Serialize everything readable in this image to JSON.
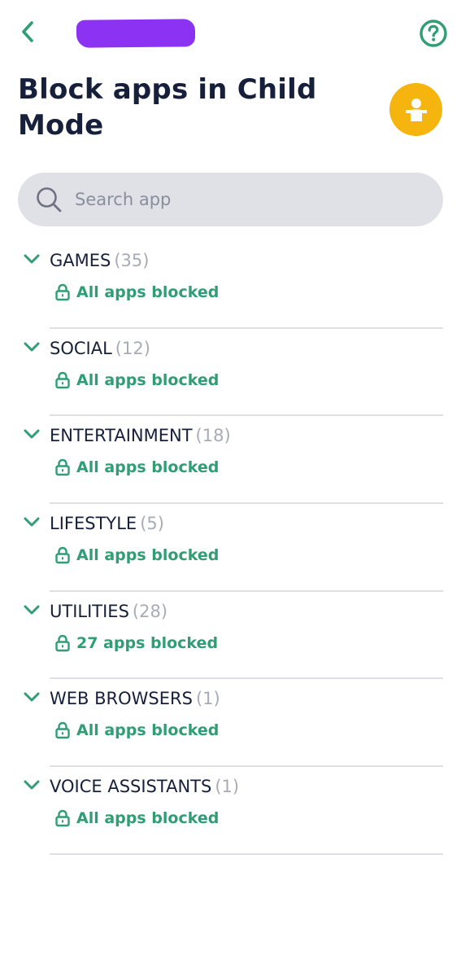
{
  "header": {
    "back_icon": "chevron-left-icon",
    "help_icon": "question-circle-icon",
    "redaction_color": "#8c32f3"
  },
  "page": {
    "title": "Block apps in Child Mode",
    "avatar_icon": "child-profile-icon",
    "avatar_color": "#f6b40e"
  },
  "search": {
    "placeholder": "Search app",
    "value": ""
  },
  "colors": {
    "accent": "#2f9e74",
    "text": "#17203b",
    "muted": "#a9abb6",
    "search_bg": "#e0e1e6"
  },
  "categories": [
    {
      "name": "GAMES",
      "count": "(35)",
      "status": "All apps blocked"
    },
    {
      "name": "SOCIAL",
      "count": "(12)",
      "status": "All apps blocked"
    },
    {
      "name": "ENTERTAINMENT",
      "count": "(18)",
      "status": "All apps blocked"
    },
    {
      "name": "LIFESTYLE",
      "count": "(5)",
      "status": "All apps blocked"
    },
    {
      "name": "UTILITIES",
      "count": "(28)",
      "status": "27 apps blocked"
    },
    {
      "name": "WEB BROWSERS",
      "count": "(1)",
      "status": "All apps blocked"
    },
    {
      "name": "VOICE ASSISTANTS",
      "count": "(1)",
      "status": "All apps blocked"
    }
  ]
}
